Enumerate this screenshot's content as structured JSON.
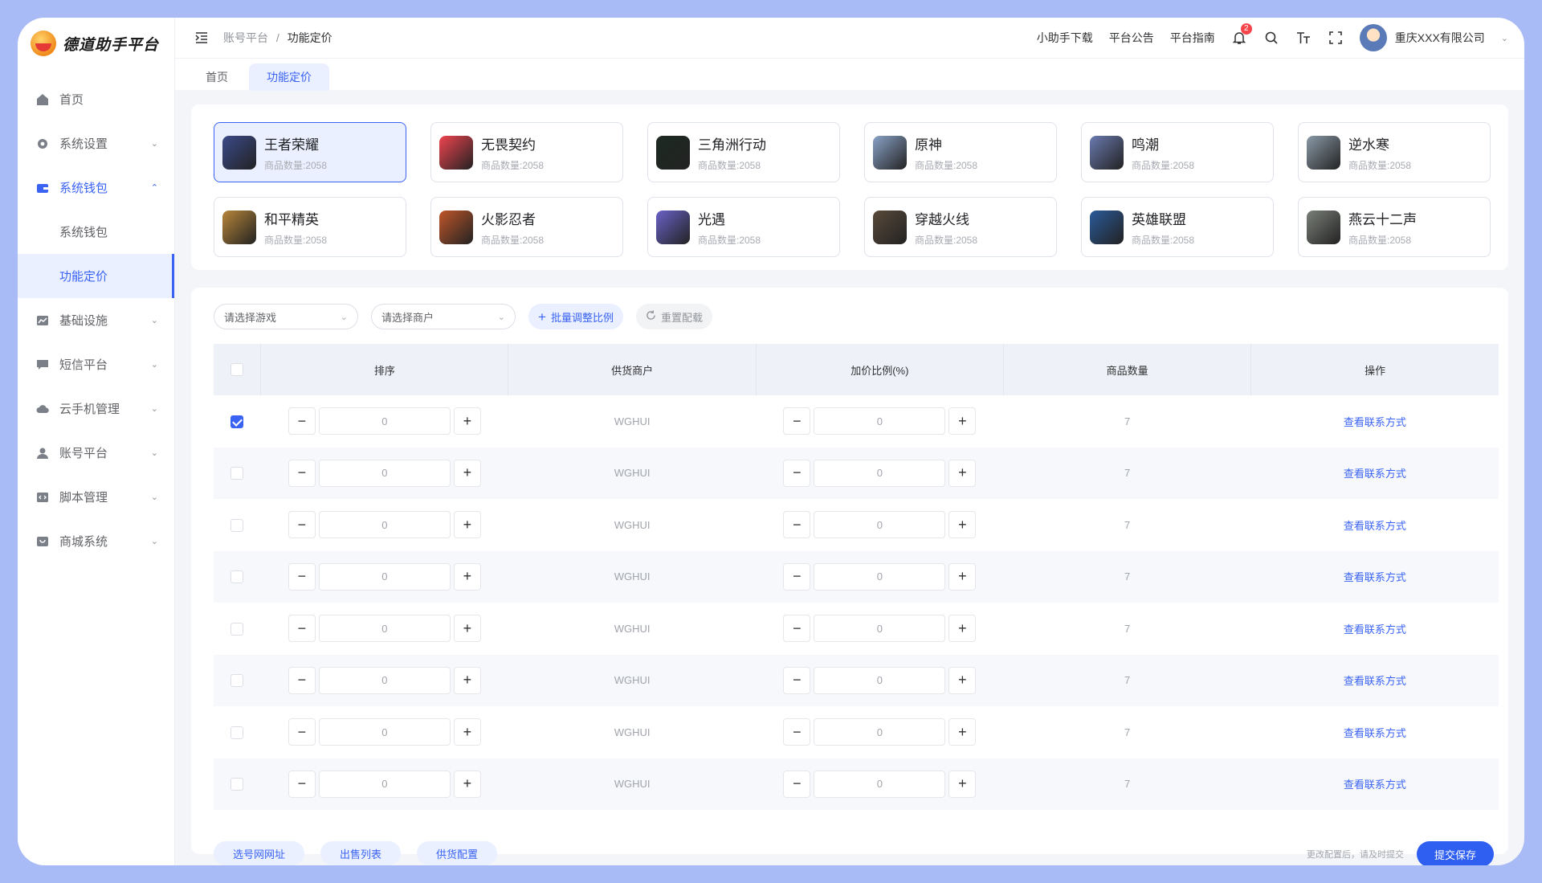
{
  "app": {
    "logo_text": "德道助手平台"
  },
  "sidebar": {
    "items": [
      {
        "label": "首页",
        "icon": "home-icon"
      },
      {
        "label": "系统设置",
        "icon": "gear-icon"
      },
      {
        "label": "系统钱包",
        "icon": "wallet-icon"
      },
      {
        "label": "系统钱包"
      },
      {
        "label": "功能定价"
      },
      {
        "label": "基础设施",
        "icon": "chart-icon"
      },
      {
        "label": "短信平台",
        "icon": "message-icon"
      },
      {
        "label": "云手机管理",
        "icon": "cloud-icon"
      },
      {
        "label": "账号平台",
        "icon": "user-icon"
      },
      {
        "label": "脚本管理",
        "icon": "code-icon"
      },
      {
        "label": "商城系统",
        "icon": "shop-icon"
      }
    ]
  },
  "header": {
    "breadcrumb": [
      "账号平台",
      "功能定价"
    ],
    "links": [
      "小助手下载",
      "平台公告",
      "平台指南"
    ],
    "notification_count": "2",
    "company": "重庆XXX有限公司"
  },
  "tabs": [
    "首页",
    "功能定价"
  ],
  "games": [
    {
      "name": "王者荣耀",
      "count": "商品数量:2058",
      "color": "#3b4a8a"
    },
    {
      "name": "无畏契约",
      "count": "商品数量:2058",
      "color": "#f0444f"
    },
    {
      "name": "三角洲行动",
      "count": "商品数量:2058",
      "color": "#1d2a23"
    },
    {
      "name": "原神",
      "count": "商品数量:2058",
      "color": "#8aa3c8"
    },
    {
      "name": "鸣潮",
      "count": "商品数量:2058",
      "color": "#6a7ab0"
    },
    {
      "name": "逆水寒",
      "count": "商品数量:2058",
      "color": "#8a9aa8"
    },
    {
      "name": "和平精英",
      "count": "商品数量:2058",
      "color": "#b8863a"
    },
    {
      "name": "火影忍者",
      "count": "商品数量:2058",
      "color": "#c0562a"
    },
    {
      "name": "光遇",
      "count": "商品数量:2058",
      "color": "#6a62c8"
    },
    {
      "name": "穿越火线",
      "count": "商品数量:2058",
      "color": "#5a4a3a"
    },
    {
      "name": "英雄联盟",
      "count": "商品数量:2058",
      "color": "#2a5a9a"
    },
    {
      "name": "燕云十二声",
      "count": "商品数量:2058",
      "color": "#7a7f78"
    }
  ],
  "filters": {
    "game_placeholder": "请选择游戏",
    "merchant_placeholder": "请选择商户",
    "batch_label": "批量调整比例",
    "reset_label": "重置配载"
  },
  "table": {
    "headers": [
      "排序",
      "供货商户",
      "加价比例(%)",
      "商品数量",
      "操作"
    ],
    "rows": [
      {
        "sort": "0",
        "merchant": "WGHUI",
        "ratio": "0",
        "qty": "7",
        "action": "查看联系方式",
        "checked": true
      },
      {
        "sort": "0",
        "merchant": "WGHUI",
        "ratio": "0",
        "qty": "7",
        "action": "查看联系方式",
        "checked": false
      },
      {
        "sort": "0",
        "merchant": "WGHUI",
        "ratio": "0",
        "qty": "7",
        "action": "查看联系方式",
        "checked": false
      },
      {
        "sort": "0",
        "merchant": "WGHUI",
        "ratio": "0",
        "qty": "7",
        "action": "查看联系方式",
        "checked": false
      },
      {
        "sort": "0",
        "merchant": "WGHUI",
        "ratio": "0",
        "qty": "7",
        "action": "查看联系方式",
        "checked": false
      },
      {
        "sort": "0",
        "merchant": "WGHUI",
        "ratio": "0",
        "qty": "7",
        "action": "查看联系方式",
        "checked": false
      },
      {
        "sort": "0",
        "merchant": "WGHUI",
        "ratio": "0",
        "qty": "7",
        "action": "查看联系方式",
        "checked": false
      },
      {
        "sort": "0",
        "merchant": "WGHUI",
        "ratio": "0",
        "qty": "7",
        "action": "查看联系方式",
        "checked": false
      }
    ]
  },
  "footer": {
    "buttons": [
      "选号网网址",
      "出售列表",
      "供货配置"
    ],
    "hint": "更改配置后，请及时提交",
    "submit_label": "提交保存"
  },
  "colors": {
    "accent": "#3a63f3",
    "frame": "#a9bbf7"
  }
}
